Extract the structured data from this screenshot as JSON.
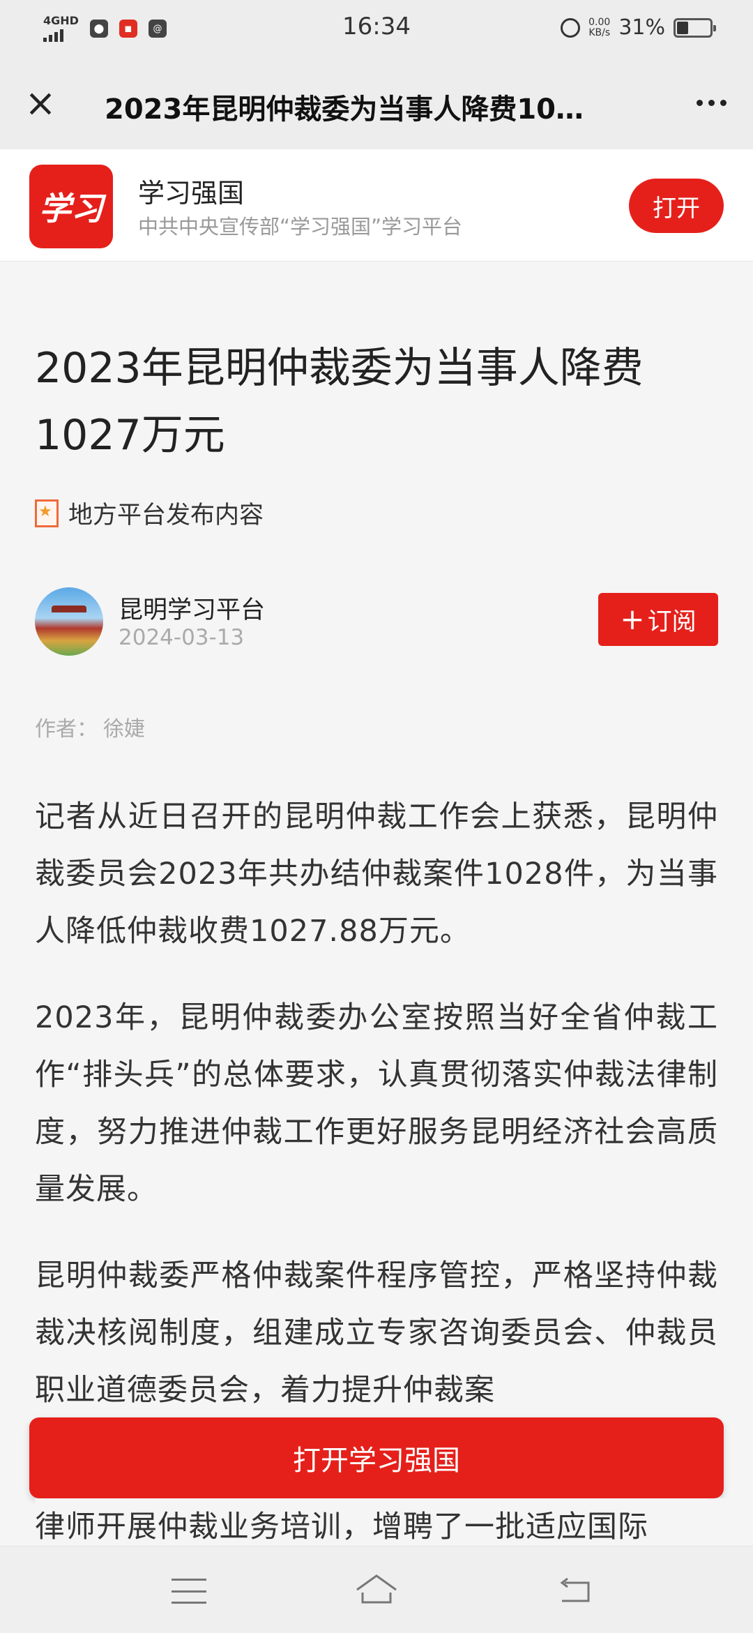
{
  "status": {
    "network": "4GHD",
    "time": "16:34",
    "speed_value": "0.00",
    "speed_unit": "KB/s",
    "battery": "31%"
  },
  "nav": {
    "title": "2023年昆明仲裁委为当事人降费10…"
  },
  "banner": {
    "logo_text": "学习",
    "app_name": "学习强国",
    "app_desc": "中共中央宣传部“学习强国”学习平台",
    "open_label": "打开"
  },
  "article": {
    "title": "2023年昆明仲裁委为当事人降费1027万元",
    "source_label": "地方平台发布内容",
    "publisher": "昆明学习平台",
    "date": "2024-03-13",
    "subscribe_label": "订阅",
    "author_prefix": "作者：",
    "author": "徐婕",
    "paragraphs": [
      "记者从近日召开的昆明仲裁工作会上获悉，昆明仲裁委员会2023年共办结仲裁案件1028件，为当事人降低仲裁收费1027.88万元。",
      "2023年，昆明仲裁委办公室按照当好全省仲裁工作“排头兵”的总体要求，认真贯彻落实仲裁法律制度，努力推进仲裁工作更好服务昆明经济社会高质量发展。",
      "昆明仲裁委严格仲裁案件程序管控，严格坚持仲裁裁决核阅制度，组建成立专家咨询委员会、仲裁员职业道德委员会，着力提升仲裁案"
    ],
    "tail_line": "律师开展仲裁业务培训，增聘了一批适应国际"
  },
  "cta": {
    "label": "打开学习强国"
  },
  "colors": {
    "brand_red": "#e5201b",
    "page_bg": "#f5f5f5"
  }
}
